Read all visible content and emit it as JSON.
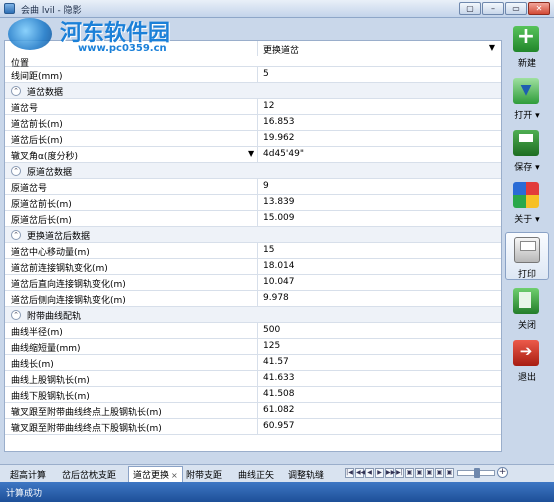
{
  "window": {
    "title": "会曲 lvil - 隐影",
    "buttons": [
      "▢",
      "–",
      "▭",
      "✕"
    ]
  },
  "watermark": {
    "title": "河东软件园",
    "url": "www.pc0359.cn"
  },
  "properties": {
    "top": {
      "position_label": "位置",
      "position_value": "更换道岔",
      "spacing_label": "线间距(mm)",
      "spacing_value": "5"
    },
    "group1": {
      "title": "道岔数据",
      "rows": [
        {
          "label": "道岔号",
          "value": "12"
        },
        {
          "label": "道岔前长(m)",
          "value": "16.853"
        },
        {
          "label": "道岔后长(m)",
          "value": "19.962"
        },
        {
          "label": "辙叉角α(度分秒)",
          "value": "4d45'49\""
        }
      ]
    },
    "group2": {
      "title": "原道岔数据",
      "rows": [
        {
          "label": "原道岔号",
          "value": "9"
        },
        {
          "label": "原道岔前长(m)",
          "value": "13.839"
        },
        {
          "label": "原道岔后长(m)",
          "value": "15.009"
        }
      ]
    },
    "group3": {
      "title": "更换道岔后数据",
      "rows": [
        {
          "label": "道岔中心移动量(m)",
          "value": "15"
        },
        {
          "label": "道岔前连接钢轨变化(m)",
          "value": "18.014"
        },
        {
          "label": "道岔后直向连接钢轨变化(m)",
          "value": "10.047"
        },
        {
          "label": "道岔后侧向连接钢轨变化(m)",
          "value": "9.978"
        }
      ]
    },
    "group4": {
      "title": "附带曲线配轨",
      "rows": [
        {
          "label": "曲线半径(m)",
          "value": "500"
        },
        {
          "label": "曲线缩短量(mm)",
          "value": "125"
        },
        {
          "label": "曲线长(m)",
          "value": "41.57"
        },
        {
          "label": "曲线上股钢轨长(m)",
          "value": "41.633"
        },
        {
          "label": "曲线下股钢轨长(m)",
          "value": "41.508"
        },
        {
          "label": "辙叉跟至附带曲线终点上股钢轨长(m)",
          "value": "61.082"
        },
        {
          "label": "辙叉跟至附带曲线终点下股钢轨长(m)",
          "value": "60.957"
        }
      ]
    }
  },
  "toolbar": {
    "new": "新建",
    "open": "打开 ▾",
    "save": "保存 ▾",
    "about": "关于 ▾",
    "print": "打印",
    "close": "关闭",
    "exit": "退出"
  },
  "tabs": [
    {
      "label": "超高计算"
    },
    {
      "label": "岔后岔枕支距"
    },
    {
      "label": "道岔更换",
      "active": true
    },
    {
      "label": "附带支距"
    },
    {
      "label": "曲线正矢"
    },
    {
      "label": "调整轨缝"
    }
  ],
  "tab_close_glyph": "×",
  "nav_glyphs": [
    "|◀",
    "◀◀",
    "◀",
    "▶",
    "▶▶",
    "▶|",
    "▣",
    "▣",
    "▣",
    "▣",
    "▣"
  ],
  "zoom_plus": "+",
  "status": {
    "text": "计算成功"
  }
}
